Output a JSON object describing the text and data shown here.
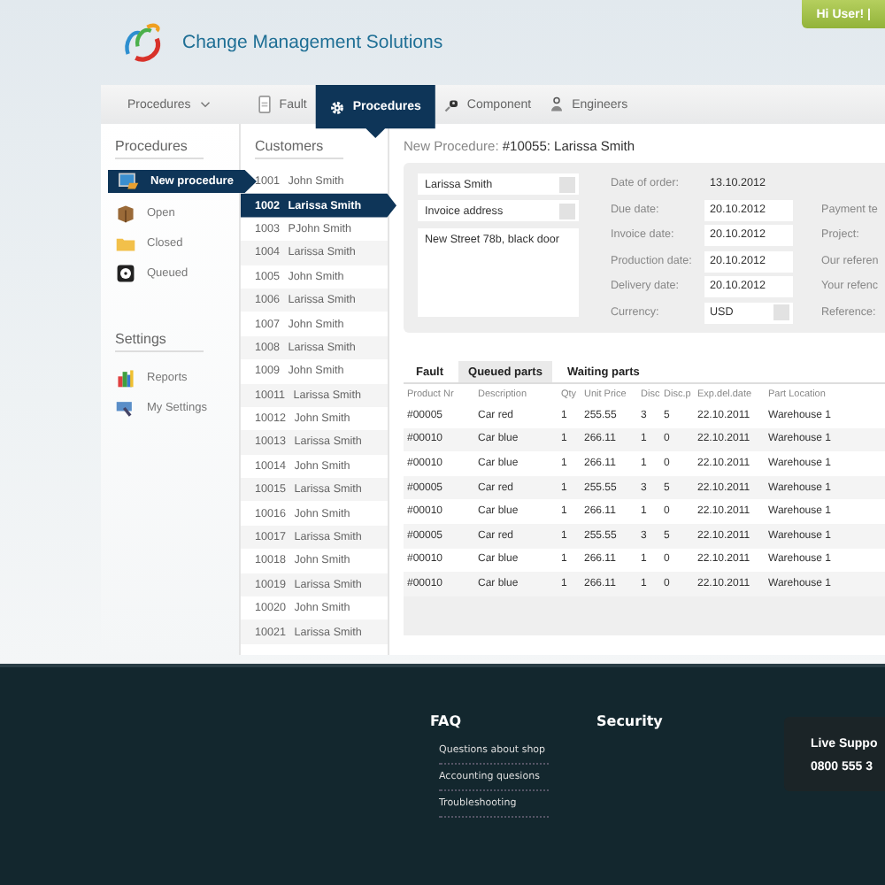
{
  "header": {
    "brand": "Change Management Solutions",
    "user_badge": "Hi User! |"
  },
  "nav": [
    {
      "label": "Procedures",
      "kind": "dropdown",
      "selected": false
    },
    {
      "label": "Fault",
      "kind": "link",
      "selected": false
    },
    {
      "label": "Procedures",
      "kind": "link",
      "selected": true
    },
    {
      "label": "Component",
      "kind": "link",
      "selected": false
    },
    {
      "label": "Engineers",
      "kind": "link",
      "selected": false
    }
  ],
  "sidebar": [
    {
      "heading": "Procedures",
      "items": [
        {
          "label": "New procedure",
          "selected": true
        },
        {
          "label": "Open",
          "selected": false
        },
        {
          "label": "Closed",
          "selected": false
        },
        {
          "label": "Queued",
          "selected": false
        }
      ]
    },
    {
      "heading": "Settings",
      "items": [
        {
          "label": "Reports",
          "selected": false
        },
        {
          "label": "My Settings",
          "selected": false
        }
      ]
    }
  ],
  "customers": {
    "heading": "Customers",
    "rows": [
      {
        "id": "1001",
        "name": "John Smith",
        "selected": false
      },
      {
        "id": "1002",
        "name": "Larissa Smith",
        "selected": true
      },
      {
        "id": "1003",
        "name": "PJohn Smith",
        "selected": false
      },
      {
        "id": "1004",
        "name": "Larissa Smith",
        "selected": false
      },
      {
        "id": "1005",
        "name": "John Smith",
        "selected": false
      },
      {
        "id": "1006",
        "name": "Larissa Smith",
        "selected": false
      },
      {
        "id": "1007",
        "name": "John Smith",
        "selected": false
      },
      {
        "id": "1008",
        "name": "Larissa Smith",
        "selected": false
      },
      {
        "id": "1009",
        "name": "John Smith",
        "selected": false
      },
      {
        "id": "10011",
        "name": "Larissa Smith",
        "selected": false
      },
      {
        "id": "10012",
        "name": "John Smith",
        "selected": false
      },
      {
        "id": "10013",
        "name": "Larissa Smith",
        "selected": false
      },
      {
        "id": "10014",
        "name": "John Smith",
        "selected": false
      },
      {
        "id": "10015",
        "name": "Larissa Smith",
        "selected": false
      },
      {
        "id": "10016",
        "name": "John Smith",
        "selected": false
      },
      {
        "id": "10017",
        "name": "Larissa Smith",
        "selected": false
      },
      {
        "id": "10018",
        "name": "John Smith",
        "selected": false
      },
      {
        "id": "10019",
        "name": "Larissa Smith",
        "selected": false
      },
      {
        "id": "10020",
        "name": "John Smith",
        "selected": false
      },
      {
        "id": "10021",
        "name": "Larissa Smith",
        "selected": false
      }
    ]
  },
  "procedure": {
    "title_prefix": "New Procedure:",
    "title": "#10055: Larissa Smith"
  },
  "form": {
    "customer": {
      "value": "Larissa Smith"
    },
    "address_type": {
      "value": "Invoice address"
    },
    "address": {
      "value": "New Street 78b, black door"
    },
    "fields": [
      {
        "label": "Date of order:",
        "value": "13.10.2012",
        "kind": "text"
      },
      {
        "label": "Due date:",
        "value": "20.10.2012",
        "kind": "input",
        "side_label": "Payment te"
      },
      {
        "label": "Invoice date:",
        "value": "20.10.2012",
        "kind": "input",
        "side_label": "Project:"
      },
      {
        "label": "Production date:",
        "value": "20.10.2012",
        "kind": "input",
        "side_label": "Our referen"
      },
      {
        "label": "Delivery date:",
        "value": "20.10.2012",
        "kind": "input",
        "side_label": "Your refenc"
      },
      {
        "label": "Currency:",
        "value": "USD",
        "kind": "select",
        "side_label": "Reference:"
      }
    ]
  },
  "parts": {
    "tabs": [
      {
        "label": "Fault",
        "selected": false
      },
      {
        "label": "Queued parts",
        "selected": true
      },
      {
        "label": "Waiting parts",
        "selected": false
      }
    ],
    "columns": [
      "Product Nr",
      "Description",
      "Qty",
      "Unit Price",
      "Disc",
      "Disc.p",
      "Exp.del.date",
      "Part Location"
    ],
    "rows": [
      [
        "#00005",
        "Car red",
        "1",
        "255.55",
        "3",
        "5",
        "22.10.2011",
        "Warehouse 1"
      ],
      [
        "#00010",
        "Car blue",
        "1",
        "266.11",
        "1",
        "0",
        "22.10.2011",
        "Warehouse 1"
      ],
      [
        "#00010",
        "Car blue",
        "1",
        "266.11",
        "1",
        "0",
        "22.10.2011",
        "Warehouse 1"
      ],
      [
        "#00005",
        "Car red",
        "1",
        "255.55",
        "3",
        "5",
        "22.10.2011",
        "Warehouse 1"
      ],
      [
        "#00010",
        "Car blue",
        "1",
        "266.11",
        "1",
        "0",
        "22.10.2011",
        "Warehouse 1"
      ],
      [
        "#00005",
        "Car red",
        "1",
        "255.55",
        "3",
        "5",
        "22.10.2011",
        "Warehouse 1"
      ],
      [
        "#00010",
        "Car blue",
        "1",
        "266.11",
        "1",
        "0",
        "22.10.2011",
        "Warehouse 1"
      ],
      [
        "#00010",
        "Car blue",
        "1",
        "266.11",
        "1",
        "0",
        "22.10.2011",
        "Warehouse 1"
      ]
    ]
  },
  "footer": {
    "columns": [
      {
        "heading": "FAQ",
        "links": [
          "Questions about shop",
          "Accounting quesions",
          "Troubleshooting"
        ]
      },
      {
        "heading": "Security"
      }
    ],
    "support": {
      "title": "Live Suppo",
      "phone": "0800 555 3"
    }
  }
}
